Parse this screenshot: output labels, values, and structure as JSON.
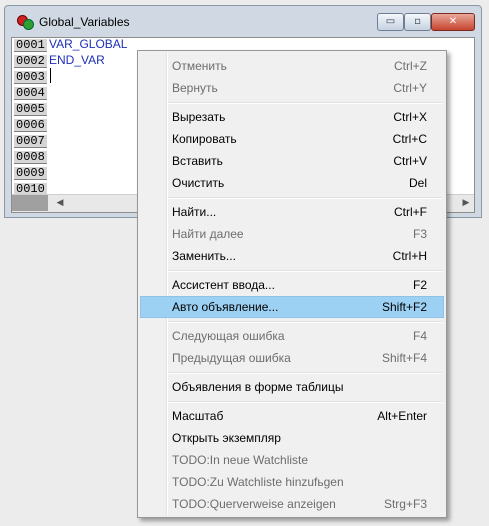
{
  "window": {
    "title": "Global_Variables",
    "min_glyph": "▭",
    "max_glyph": "▫",
    "close_glyph": "✕"
  },
  "editor": {
    "line_numbers": [
      "0001",
      "0002",
      "0003",
      "0004",
      "0005",
      "0006",
      "0007",
      "0008",
      "0009",
      "0010"
    ],
    "lines": [
      "VAR_GLOBAL",
      "END_VAR"
    ],
    "text_color": "#1d2fb9",
    "scroll_left": "◀",
    "scroll_right": "▶"
  },
  "menu": {
    "items": [
      {
        "label": "Отменить",
        "shortcut": "Ctrl+Z",
        "enabled": false
      },
      {
        "label": "Вернуть",
        "shortcut": "Ctrl+Y",
        "enabled": false
      },
      {
        "label": "Вырезать",
        "shortcut": "Ctrl+X",
        "enabled": true
      },
      {
        "label": "Копировать",
        "shortcut": "Ctrl+C",
        "enabled": true
      },
      {
        "label": "Вставить",
        "shortcut": "Ctrl+V",
        "enabled": true
      },
      {
        "label": "Очистить",
        "shortcut": "Del",
        "enabled": true
      },
      {
        "label": "Найти...",
        "shortcut": "Ctrl+F",
        "enabled": true
      },
      {
        "label": "Найти далее",
        "shortcut": "F3",
        "enabled": false
      },
      {
        "label": "Заменить...",
        "shortcut": "Ctrl+H",
        "enabled": true
      },
      {
        "label": "Ассистент ввода...",
        "shortcut": "F2",
        "enabled": true
      },
      {
        "label": "Авто объявление...",
        "shortcut": "Shift+F2",
        "enabled": true,
        "highlighted": true
      },
      {
        "label": "Следующая ошибка",
        "shortcut": "F4",
        "enabled": false
      },
      {
        "label": "Предыдущая ошибка",
        "shortcut": "Shift+F4",
        "enabled": false
      },
      {
        "label": "Объявления в форме таблицы",
        "shortcut": "",
        "enabled": true
      },
      {
        "label": "Масштаб",
        "shortcut": "Alt+Enter",
        "enabled": true
      },
      {
        "label": "Открыть экземпляр",
        "shortcut": "",
        "enabled": true
      },
      {
        "label": "TODO:In neue Watchliste",
        "shortcut": "",
        "enabled": false
      },
      {
        "label": "TODO:Zu Watchliste hinzufьgen",
        "shortcut": "",
        "enabled": false
      },
      {
        "label": "TODO:Querverweise anzeigen",
        "shortcut": "Strg+F3",
        "enabled": false
      }
    ],
    "highlight_color": "#9dd1f3"
  }
}
